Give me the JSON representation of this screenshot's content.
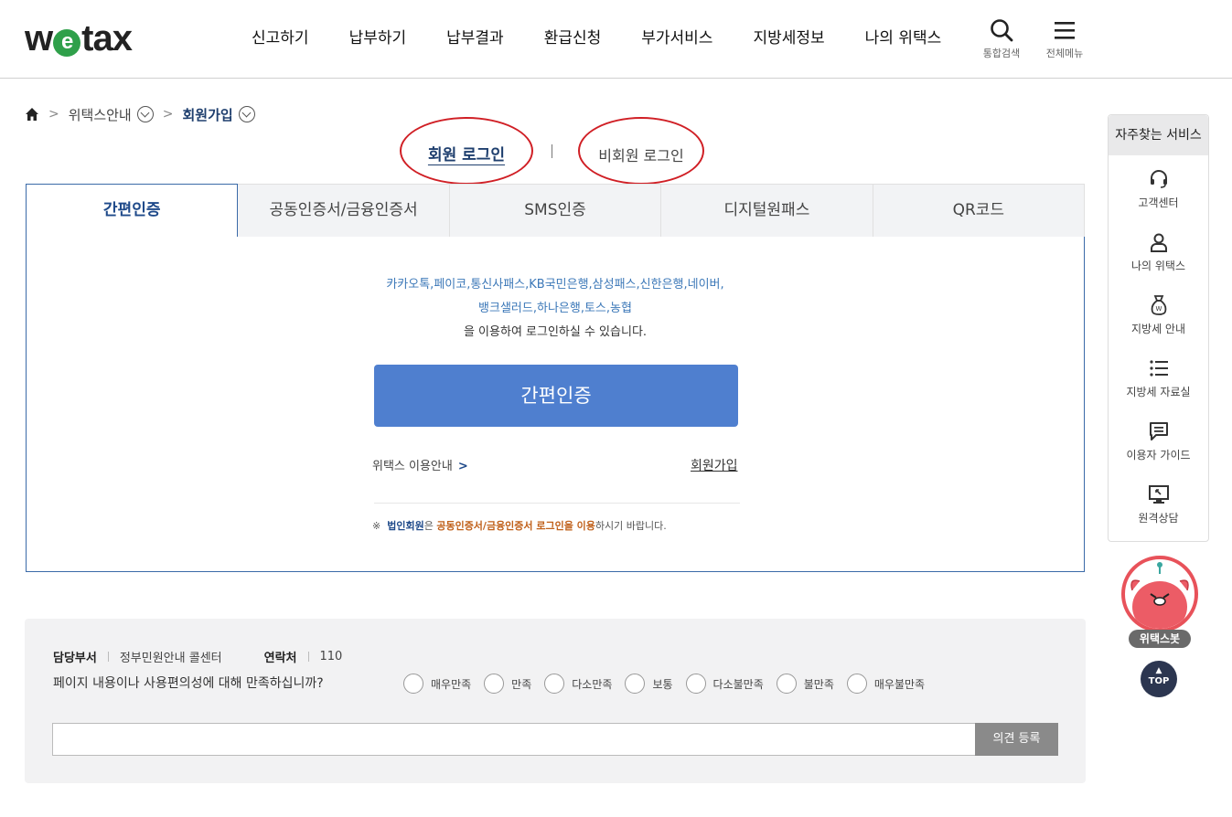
{
  "header": {
    "logo_pre": "w",
    "logo_e": "e",
    "logo_post": "tax",
    "nav": [
      "신고하기",
      "납부하기",
      "납부결과",
      "환급신청",
      "부가서비스",
      "지방세정보",
      "나의 위택스"
    ],
    "search_label": "통합검색",
    "menu_label": "전체메뉴"
  },
  "breadcrumb": {
    "level1": "위택스안내",
    "level2": "회원가입"
  },
  "login_toggle": {
    "member": "회원 로그인",
    "guest": "비회원 로그인"
  },
  "tabs": [
    "간편인증",
    "공동인증서/금융인증서",
    "SMS인증",
    "디지털원패스",
    "QR코드"
  ],
  "content": {
    "providers_line1": "카카오톡,페이코,통신사패스,KB국민은행,삼성패스,신한은행,네이버,",
    "providers_line2": "뱅크샐러드,하나은행,토스,농협",
    "instruction": "을 이용하여 로그인하실 수 있습니다.",
    "button": "간편인증",
    "guide_link": "위택스 이용안내",
    "join_link": "회원가입",
    "notice_mark": "※",
    "notice_part1": "법인회원",
    "notice_part2": "은 ",
    "notice_part3": "공동인증서/금융인증서 로그인을 이용",
    "notice_part4": "하시기 바랍니다."
  },
  "survey": {
    "dept_label": "담당부서",
    "dept_value": "정부민원안내 콜센터",
    "contact_label": "연락처",
    "contact_value": "110",
    "question": "페이지 내용이나 사용편의성에 대해 만족하십니까?",
    "options": [
      "매우만족",
      "만족",
      "다소만족",
      "보통",
      "다소불만족",
      "불만족",
      "매우불만족"
    ],
    "input_placeholder": "",
    "submit": "의견 등록"
  },
  "quick_menu": {
    "title": "자주찾는 서비스",
    "items": [
      {
        "label": "고객센터",
        "icon": "headset-icon"
      },
      {
        "label": "나의 위택스",
        "icon": "user-icon"
      },
      {
        "label": "지방세 안내",
        "icon": "money-bag-icon"
      },
      {
        "label": "지방세 자료실",
        "icon": "list-icon"
      },
      {
        "label": "이용자 가이드",
        "icon": "chat-icon"
      },
      {
        "label": "원격상담",
        "icon": "monitor-icon"
      }
    ]
  },
  "bot": {
    "label": "위택스봇"
  },
  "top_button": {
    "label": "TOP"
  },
  "colors": {
    "accent_blue": "#4f7fcf",
    "dark_blue": "#1f4a8a",
    "highlight_red": "#d01f25",
    "logo_green": "#2fa04a"
  }
}
